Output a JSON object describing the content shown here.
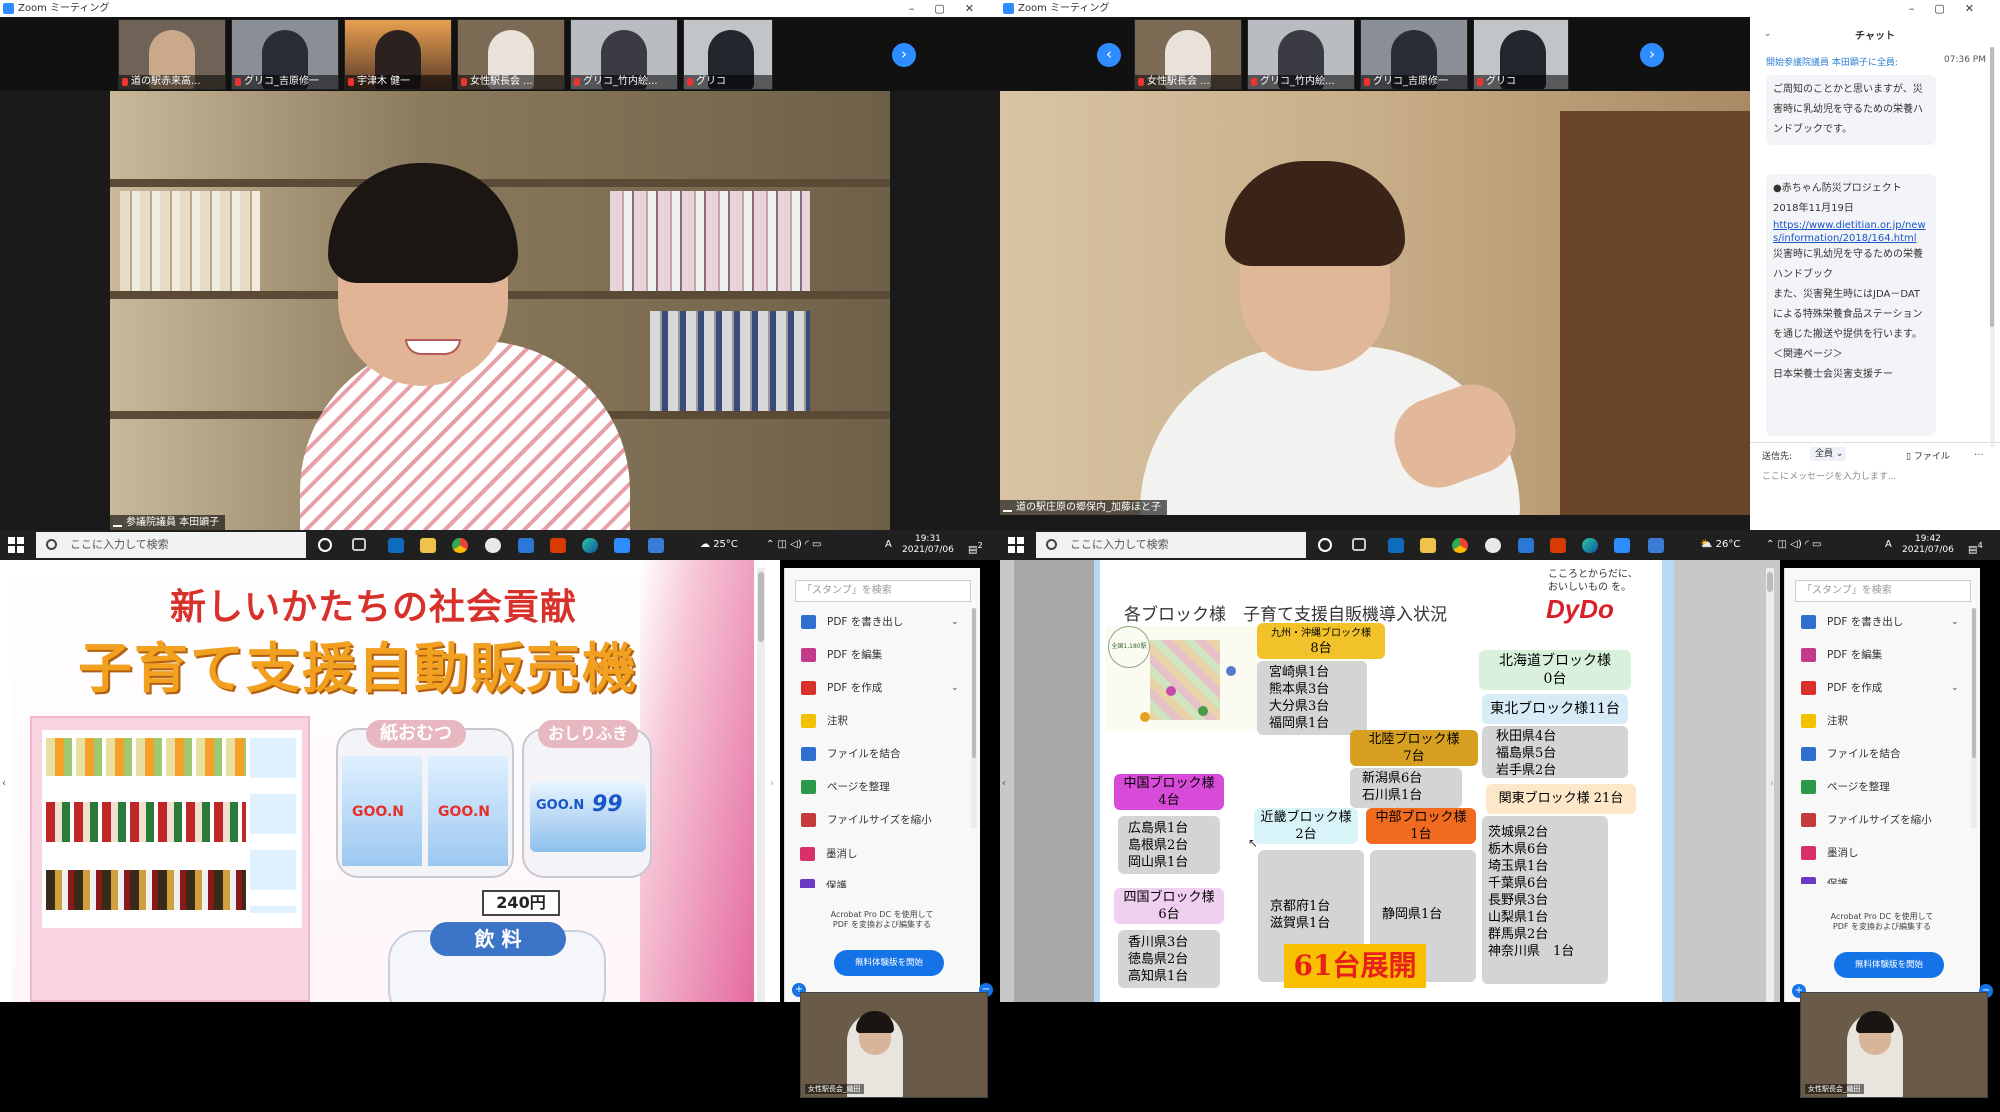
{
  "window_title": "Zoom ミーティング",
  "left_meeting": {
    "thumbnails": [
      "道の駅赤来高...",
      "グリコ_吉原修一",
      "宇津木 健一",
      "女性駅長会 ...",
      "グリコ_竹内絵...",
      "グリコ"
    ],
    "speaker_name": "参議院議員 本田顕子"
  },
  "right_meeting": {
    "thumbnails": [
      "女性駅長会 ...",
      "グリコ_竹内絵...",
      "グリコ_吉原修一",
      "グリコ"
    ],
    "speaker_name": "道の駅庄原の郷保内_加藤ほと子"
  },
  "chat": {
    "title": "チャット",
    "from": "開始参議院議員 本田顕子に全員:",
    "time": "07:36 PM",
    "message1": "ご周知のことかと思いますが、災害時に乳幼児を守るための栄養ハンドブックです。",
    "message2_lines": [
      "●赤ちゃん防災プロジェクト",
      "2018年11月19日"
    ],
    "link": "https://www.dietitian.or.jp/news/information/2018/164.html",
    "message2_rest": [
      "災害時に乳幼児を守るための栄養ハンドブック",
      "また、災害発生時にはJDA－DATによる特殊栄養食品ステーションを通じた搬送や提供を行います。",
      "＜関連ページ＞",
      "日本栄養士会災害支援チー"
    ],
    "send_to_label": "送信先:",
    "send_to_value": "全員",
    "file_label": "ファイル",
    "more_label": "...",
    "input_placeholder": "ここにメッセージを入力します..."
  },
  "taskbar_left": {
    "search_placeholder": "ここに入力して検索",
    "weather": "25°C",
    "ime": "A",
    "time": "19:31",
    "date": "2021/07/06",
    "notif_count": "2"
  },
  "taskbar_right": {
    "search_placeholder": "ここに入力して検索",
    "weather": "26°C",
    "ime": "A",
    "time": "19:42",
    "date": "2021/07/06",
    "notif_count": "4"
  },
  "acrobat": {
    "search_placeholder": "「スタンプ」を検索",
    "items": [
      "PDF を書き出し",
      "PDF を編集",
      "PDF を作成",
      "注釈",
      "ファイルを結合",
      "ページを整理",
      "ファイルサイズを縮小",
      "墨消し",
      "保護"
    ],
    "promo_line1": "Acrobat Pro DC を使用して",
    "promo_line2": "PDF を変換および編集する",
    "trial_button": "無料体験版を開始"
  },
  "selfview_label": "女性駅長会_織田",
  "slide_left": {
    "subtitle": "新しいかたちの社会貢献",
    "title": "子育て支援自動販売機",
    "diaper_label": "紙おむつ",
    "wipes_label": "おしりふき",
    "price": "240円",
    "drinks_label": "飲 料",
    "brand1": "GOO.N",
    "brand2": "GOO.N",
    "wipes_brand": "GOO.N",
    "wipes_pct": "99"
  },
  "slide_right": {
    "title": "各ブロック様　子育て支援自販機導入状況",
    "tagline1": "こころとからだに、",
    "tagline2": "おいしいもの を。",
    "logo": "DyDo",
    "map_caption": "全国1,180駅",
    "blocks": {
      "kyushu": {
        "name": "九州・沖縄ブロック様",
        "count": "8台",
        "prefs": [
          "宮崎県1台",
          "熊本県3台",
          "大分県3台",
          "福岡県1台"
        ]
      },
      "hokkaido": {
        "name": "北海道ブロック様",
        "count": "0台"
      },
      "tohoku": {
        "name": "東北ブロック様11台",
        "prefs": [
          "秋田県4台",
          "福島県5台",
          "岩手県2台"
        ]
      },
      "hokuriku": {
        "name": "北陸ブロック様",
        "count": "7台",
        "prefs": [
          "新潟県6台",
          "石川県1台"
        ]
      },
      "chugoku": {
        "name": "中国ブロック様",
        "count": "4台",
        "prefs": [
          "広島県1台",
          "島根県2台",
          "岡山県1台"
        ]
      },
      "kinki": {
        "name": "近畿ブロック様",
        "count": "2台",
        "prefs": [
          "京都府1台",
          "滋賀県1台"
        ]
      },
      "chubu": {
        "name": "中部ブロック様",
        "count": "1台",
        "prefs": [
          "静岡県1台"
        ]
      },
      "kanto": {
        "name": "関東ブロック様 21台",
        "prefs": [
          "茨城県2台",
          "栃木県6台",
          "埼玉県1台",
          "千葉県6台",
          "長野県3台",
          "山梨県1台",
          "群馬県2台",
          "神奈川県　1台"
        ]
      },
      "shikoku": {
        "name": "四国ブロック様",
        "count": "6台",
        "prefs": [
          "香川県3台",
          "徳島県2台",
          "高知県1台"
        ]
      }
    },
    "total": "61台展開"
  }
}
